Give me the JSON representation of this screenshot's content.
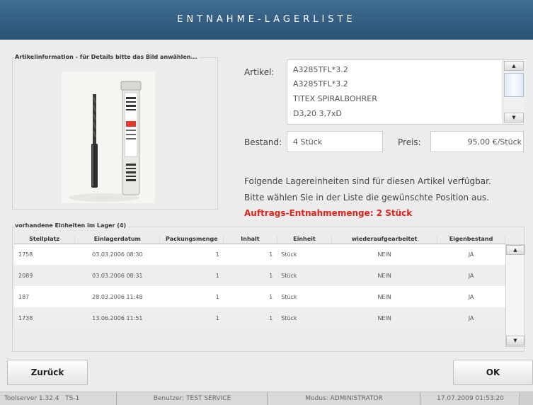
{
  "header": {
    "title": "ENTNAHME-LAGERLISTE"
  },
  "article_panel": {
    "legend": "Artikelinformation - für Details bitte das Bild anwählen...",
    "image": "drill-bit-product-photo",
    "label_article": "Artikel:",
    "article_lines": [
      "A3285TFL*3.2",
      "A3285TFL*3.2",
      "TITEX SPIRALBOHRER",
      "D3,20 3,7xD"
    ],
    "label_stock": "Bestand:",
    "stock_value": "4 Stück",
    "label_price": "Preis:",
    "price_value": "95,00 €/Stück",
    "message_line1": "Folgende Lagereinheiten sind für diesen Artikel verfügbar.",
    "message_line2": "Bitte wählen Sie in der Liste die gewünschte Position aus.",
    "order_quantity": "Auftrags-Entnahmemenge: 2 Stück"
  },
  "units_panel": {
    "legend": "vorhandene Einheiten im Lager (4)",
    "columns": [
      "Stellplatz",
      "Einlagerdatum",
      "Packungsmenge",
      "Inhalt",
      "Einheit",
      "wiederaufgearbeitet",
      "Eigenbestand"
    ],
    "rows": [
      [
        "1758",
        "03.03.2006 08:30",
        "1",
        "1",
        "Stück",
        "NEIN",
        "JA"
      ],
      [
        "2089",
        "03.03.2006 08:31",
        "1",
        "1",
        "Stück",
        "NEIN",
        "JA"
      ],
      [
        "187",
        "28.03.2006 11:48",
        "1",
        "1",
        "Stück",
        "NEIN",
        "JA"
      ],
      [
        "1738",
        "13.06.2006 11:51",
        "1",
        "1",
        "Stück",
        "NEIN",
        "JA"
      ]
    ]
  },
  "buttons": {
    "back": "Zurück",
    "ok": "OK"
  },
  "statusbar": {
    "server": "Toolserver 1.32.4",
    "terminal": "TS-1",
    "user": "Benutzer: TEST SERVICE",
    "mode": "Modus: ADMINISTRATOR",
    "datetime": "17.07.2009 01:53:20"
  },
  "colors": {
    "header": "#2f5b7f",
    "accent_red": "#e0231b",
    "background": "#ececec"
  }
}
